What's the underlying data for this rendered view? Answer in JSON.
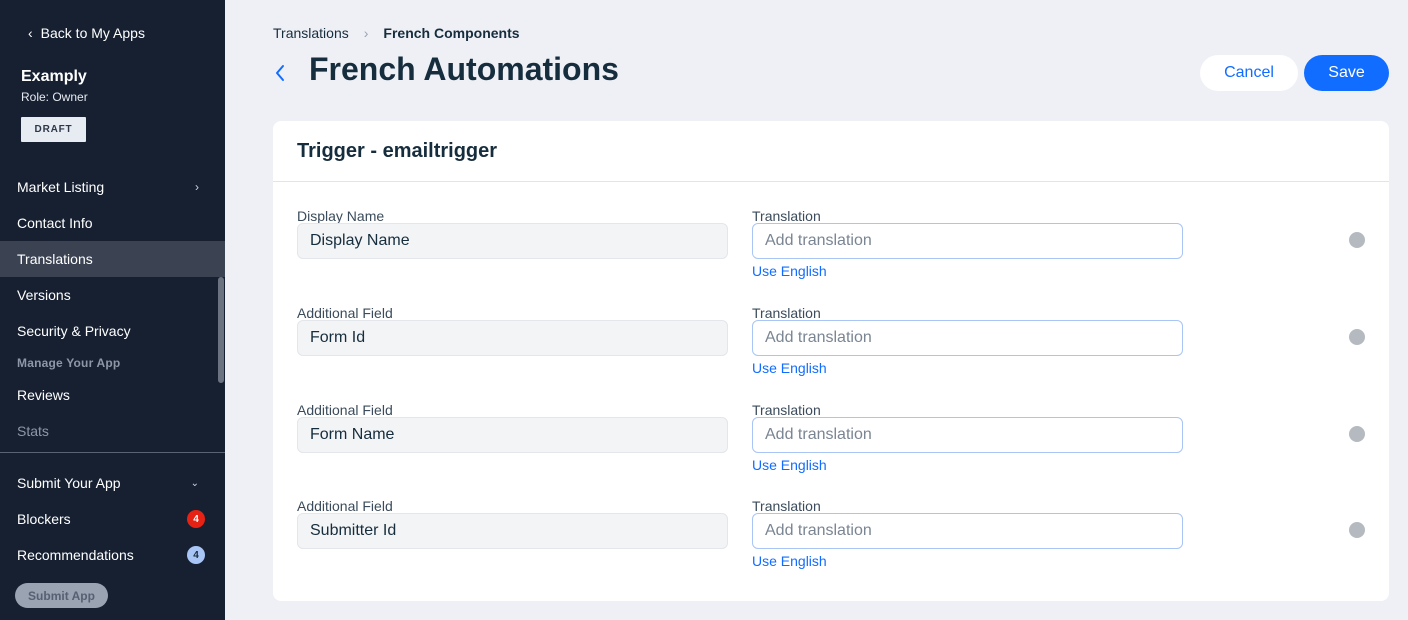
{
  "sidebar": {
    "back_label": "Back to My Apps",
    "app_name": "Examply",
    "role": "Role: Owner",
    "status_badge": "DRAFT",
    "items": [
      {
        "label": "Market Listing"
      },
      {
        "label": "Contact Info"
      },
      {
        "label": "Translations"
      },
      {
        "label": "Versions"
      },
      {
        "label": "Security & Privacy"
      },
      {
        "label": "Reviews"
      },
      {
        "label": "Stats"
      },
      {
        "label": "Submit Your App"
      },
      {
        "label": "Blockers",
        "count": "4"
      },
      {
        "label": "Recommendations",
        "count": "4"
      }
    ],
    "section_manage": "Manage Your App",
    "submit_button": "Submit App"
  },
  "breadcrumb": {
    "parent": "Translations",
    "current": "French Components"
  },
  "header": {
    "title": "French Automations",
    "cancel_label": "Cancel",
    "save_label": "Save"
  },
  "card": {
    "title": "Trigger - emailtrigger",
    "rows": [
      {
        "source_label": "Display Name",
        "source_value": "Display Name",
        "translation_label": "Translation",
        "placeholder": "Add translation",
        "use_english": "Use English"
      },
      {
        "source_label": "Additional Field",
        "source_value": "Form Id",
        "translation_label": "Translation",
        "placeholder": "Add translation",
        "use_english": "Use English"
      },
      {
        "source_label": "Additional Field",
        "source_value": "Form Name",
        "translation_label": "Translation",
        "placeholder": "Add translation",
        "use_english": "Use English"
      },
      {
        "source_label": "Additional Field",
        "source_value": "Submitter Id",
        "translation_label": "Translation",
        "placeholder": "Add translation",
        "use_english": "Use English"
      }
    ]
  },
  "colors": {
    "accent": "#116dff",
    "sidebar_bg": "#162031",
    "blocker_badge": "#e62214",
    "recommendation_badge": "#a8c5f5"
  }
}
